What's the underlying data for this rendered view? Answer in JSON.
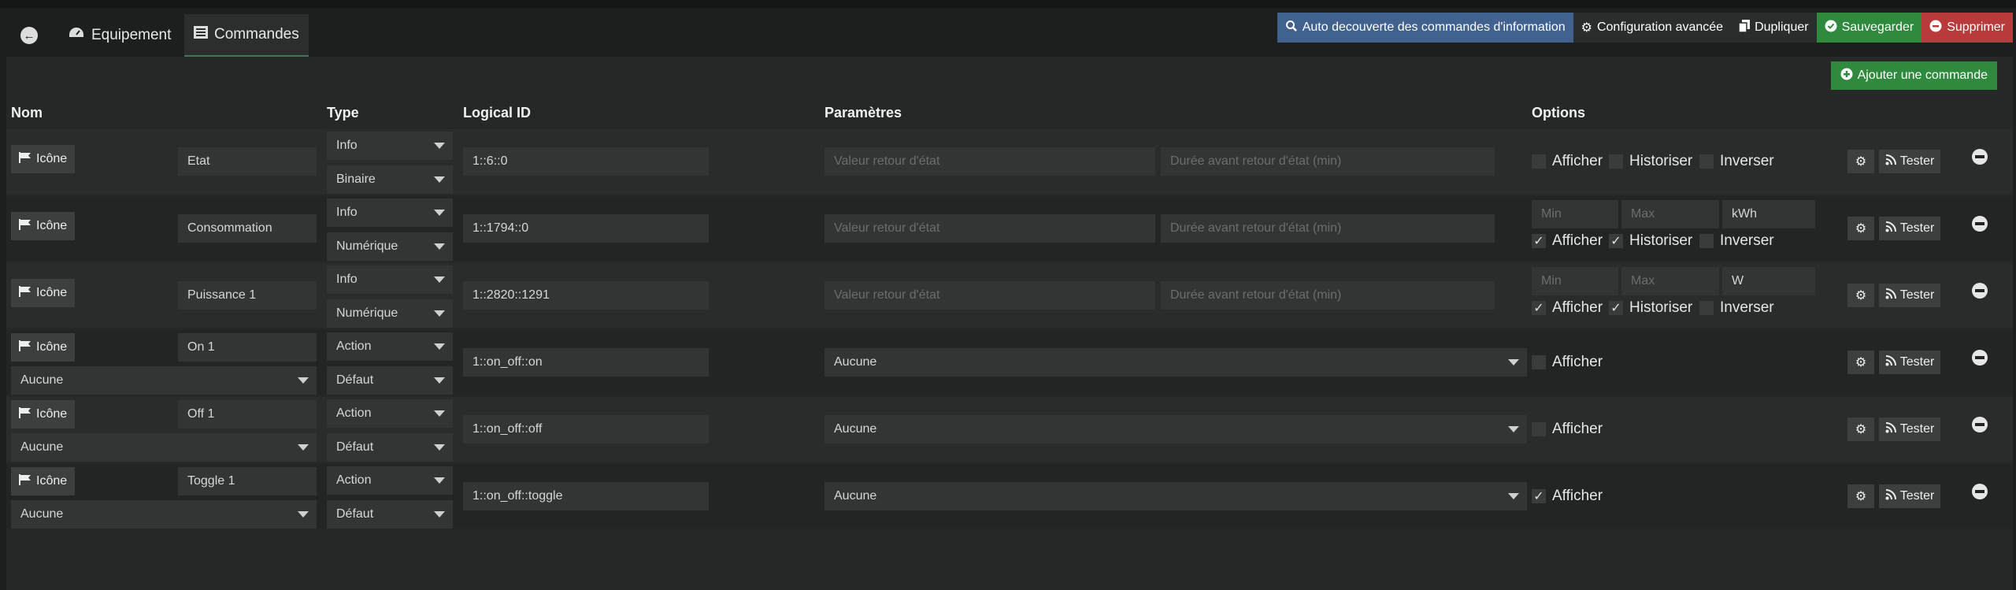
{
  "tabs": [
    {
      "label": "Equipement"
    },
    {
      "label": "Commandes"
    }
  ],
  "toolbar": {
    "auto_label": "Auto decouverte des commandes d'information",
    "config_label": "Configuration avancée",
    "duplicate_label": "Dupliquer",
    "save_label": "Sauvegarder",
    "delete_label": "Supprimer"
  },
  "add_label": "Ajouter une commande",
  "headers": {
    "nom": "Nom",
    "type": "Type",
    "logical": "Logical ID",
    "params": "Paramètres",
    "options": "Options"
  },
  "common": {
    "icon_label": "Icône",
    "test_label": "Tester",
    "ph_return": "Valeur retour d'état",
    "ph_delay": "Durée avant retour d'état (min)",
    "ph_min": "Min",
    "ph_max": "Max",
    "afficher": "Afficher",
    "historiser": "Historiser",
    "inverser": "Inverser"
  },
  "rows": [
    {
      "name": "Etat",
      "type": "Info",
      "subtype": "Binaire",
      "logical": "1::6::0",
      "unit": "",
      "value_select": "",
      "afficher": false,
      "historiser": false,
      "inverser": false
    },
    {
      "name": "Consommation",
      "type": "Info",
      "subtype": "Numérique",
      "logical": "1::1794::0",
      "unit": "kWh",
      "value_select": "",
      "afficher": true,
      "historiser": true,
      "inverser": false
    },
    {
      "name": "Puissance 1",
      "type": "Info",
      "subtype": "Numérique",
      "logical": "1::2820::1291",
      "unit": "W",
      "value_select": "",
      "afficher": true,
      "historiser": true,
      "inverser": false
    },
    {
      "name": "On 1",
      "type": "Action",
      "subtype": "Défaut",
      "logical": "1::on_off::on",
      "unit": "",
      "value_select": "Aucune",
      "afficher": false,
      "historiser": false,
      "inverser": false
    },
    {
      "name": "Off 1",
      "type": "Action",
      "subtype": "Défaut",
      "logical": "1::on_off::off",
      "unit": "",
      "value_select": "Aucune",
      "afficher": false,
      "historiser": false,
      "inverser": false
    },
    {
      "name": "Toggle 1",
      "type": "Action",
      "subtype": "Défaut",
      "logical": "1::on_off::toggle",
      "unit": "",
      "value_select": "Aucune",
      "afficher": true,
      "historiser": false,
      "inverser": false
    }
  ]
}
